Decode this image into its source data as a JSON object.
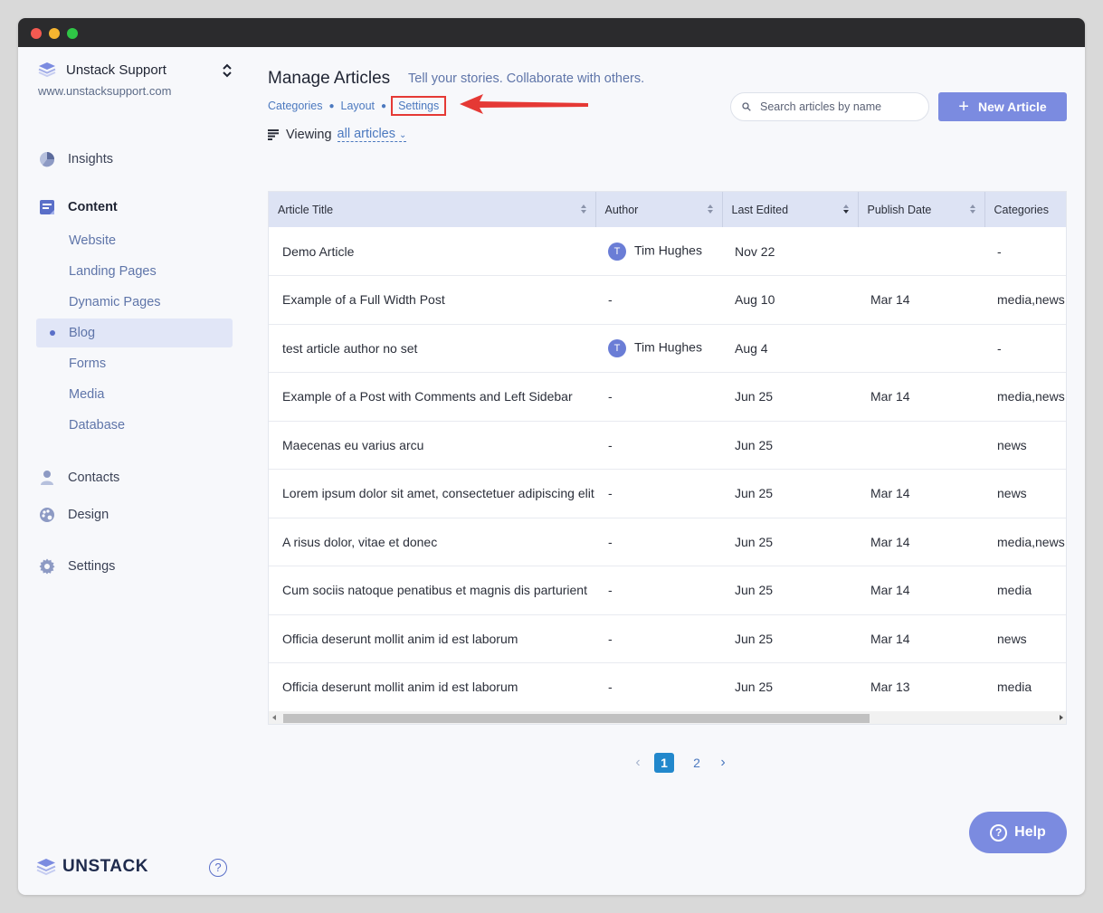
{
  "window": {
    "colors": {
      "accent": "#7b8be0",
      "link": "#4c79bf",
      "highlight": "#e53935"
    }
  },
  "sidebar": {
    "account_name": "Unstack Support",
    "account_url": "www.unstacksupport.com",
    "nav": {
      "insights": "Insights",
      "content": "Content",
      "contacts": "Contacts",
      "design": "Design",
      "settings": "Settings"
    },
    "content_items": [
      "Website",
      "Landing Pages",
      "Dynamic Pages",
      "Blog",
      "Forms",
      "Media",
      "Database"
    ],
    "active_item": "Blog",
    "footer_logo": "UNSTACK",
    "footer_help": "?"
  },
  "header": {
    "title": "Manage Articles",
    "subtitle": "Tell your stories. Collaborate with others.",
    "subnav": [
      "Categories",
      "Layout",
      "Settings"
    ],
    "viewing_label": "Viewing",
    "viewing_value": "all articles",
    "search_placeholder": "Search articles by name",
    "new_button": "New Article"
  },
  "table": {
    "columns": [
      "Article Title",
      "Author",
      "Last Edited",
      "Publish Date",
      "Categories"
    ],
    "rows": [
      {
        "title": "Demo Article",
        "author_initial": "T",
        "author": "Tim Hughes",
        "last_edited": "Nov 22",
        "publish_date": "",
        "categories": "-"
      },
      {
        "title": "Example of a Full Width Post",
        "author_initial": "",
        "author": "-",
        "last_edited": "Aug 10",
        "publish_date": "Mar 14",
        "categories": "media,news"
      },
      {
        "title": "test article author no set",
        "author_initial": "T",
        "author": "Tim Hughes",
        "last_edited": "Aug 4",
        "publish_date": "",
        "categories": "-"
      },
      {
        "title": "Example of a Post with Comments and Left Sidebar",
        "author_initial": "",
        "author": "-",
        "last_edited": "Jun 25",
        "publish_date": "Mar 14",
        "categories": "media,news"
      },
      {
        "title": "Maecenas eu varius arcu",
        "author_initial": "",
        "author": "-",
        "last_edited": "Jun 25",
        "publish_date": "",
        "categories": "news"
      },
      {
        "title": "Lorem ipsum dolor sit amet, consectetuer adipiscing elit",
        "author_initial": "",
        "author": "-",
        "last_edited": "Jun 25",
        "publish_date": "Mar 14",
        "categories": "news"
      },
      {
        "title": "A risus dolor, vitae et donec",
        "author_initial": "",
        "author": "-",
        "last_edited": "Jun 25",
        "publish_date": "Mar 14",
        "categories": "media,news"
      },
      {
        "title": "Cum sociis natoque penatibus et magnis dis parturient",
        "author_initial": "",
        "author": "-",
        "last_edited": "Jun 25",
        "publish_date": "Mar 14",
        "categories": "media"
      },
      {
        "title": "Officia deserunt mollit anim id est laborum",
        "author_initial": "",
        "author": "-",
        "last_edited": "Jun 25",
        "publish_date": "Mar 14",
        "categories": "news"
      },
      {
        "title": "Officia deserunt mollit anim id est laborum",
        "author_initial": "",
        "author": "-",
        "last_edited": "Jun 25",
        "publish_date": "Mar 13",
        "categories": "media"
      }
    ]
  },
  "pagination": {
    "pages": [
      "1",
      "2"
    ],
    "current": "1",
    "prev_icon": "chevron-left-icon",
    "next_icon": "chevron-right-icon"
  },
  "help_button": {
    "label": "Help",
    "icon": "?"
  }
}
